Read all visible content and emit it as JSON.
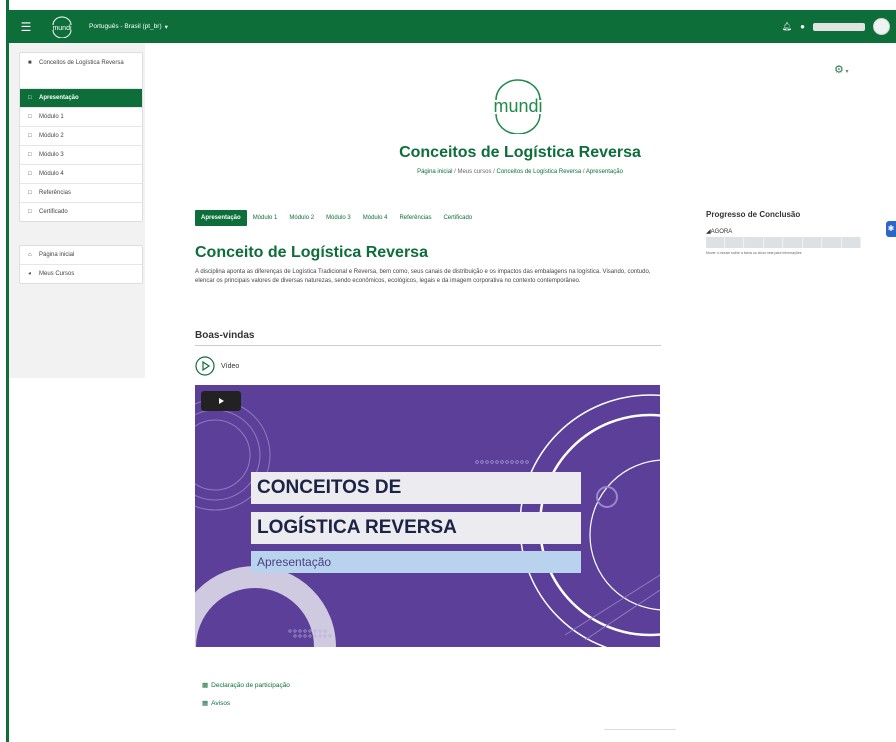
{
  "topbar": {
    "menu_icon": "hamburger-icon",
    "logo_text": "mundi",
    "language": "Português - Brasil (pt_br)",
    "notifications_icon": "bell-icon",
    "messages_icon": "chat-icon"
  },
  "sidebar": {
    "items": [
      {
        "label": "Conceitos de Logística Reversa",
        "icon": "graduation-cap-icon"
      },
      {
        "label": "Apresentação",
        "icon": "folder-icon",
        "active": true
      },
      {
        "label": "Módulo 1",
        "icon": "folder-icon"
      },
      {
        "label": "Módulo 2",
        "icon": "folder-icon"
      },
      {
        "label": "Módulo 3",
        "icon": "folder-icon"
      },
      {
        "label": "Módulo 4",
        "icon": "folder-icon"
      },
      {
        "label": "Referências",
        "icon": "folder-icon"
      },
      {
        "label": "Certificado",
        "icon": "folder-icon"
      }
    ],
    "items2": [
      {
        "label": "Página inicial",
        "icon": "home-icon"
      },
      {
        "label": "Meus Cursos",
        "icon": "tachometer-icon"
      }
    ]
  },
  "header": {
    "logo_text": "mundi",
    "course_title": "Conceitos de Logística Reversa",
    "breadcrumb": {
      "home": "Página inicial",
      "my_courses": "Meus cursos",
      "course": "Conceitos de Logística Reversa",
      "section": "Apresentação",
      "separator": "/"
    }
  },
  "tabs": [
    "Apresentação",
    "Módulo 1",
    "Módulo 2",
    "Módulo 3",
    "Módulo 4",
    "Referências",
    "Certificado"
  ],
  "section": {
    "title": "Conceito de Logística Reversa",
    "description": "A disciplina aponta as diferenças de Logística Tradicional e Reversa, bem como, seus canais de distribuição e os impactos das embalagens na logística. Visando, contudo, elencar os principais valores de diversas naturezas, sendo econômicos, ecológicos, legais e da imagem corporativa no contexto contemporâneo.",
    "welcome": "Boas-vindas",
    "video_label": "Vídeo"
  },
  "video": {
    "line1": "CONCEITOS DE",
    "line2": "LOGÍSTICA REVERSA",
    "line3": "Apresentação",
    "bg_color": "#5b3f99"
  },
  "footer_links": {
    "declaration": "Declaração de participação",
    "notices": "Avisos"
  },
  "progress": {
    "title": "Progresso de Conclusão",
    "now": "AGORA",
    "hint": "Mover o mouse sobre a barra ou clicar nela para informações"
  },
  "colors": {
    "brand": "#0d6e3a",
    "video_purple": "#5b3f99"
  }
}
